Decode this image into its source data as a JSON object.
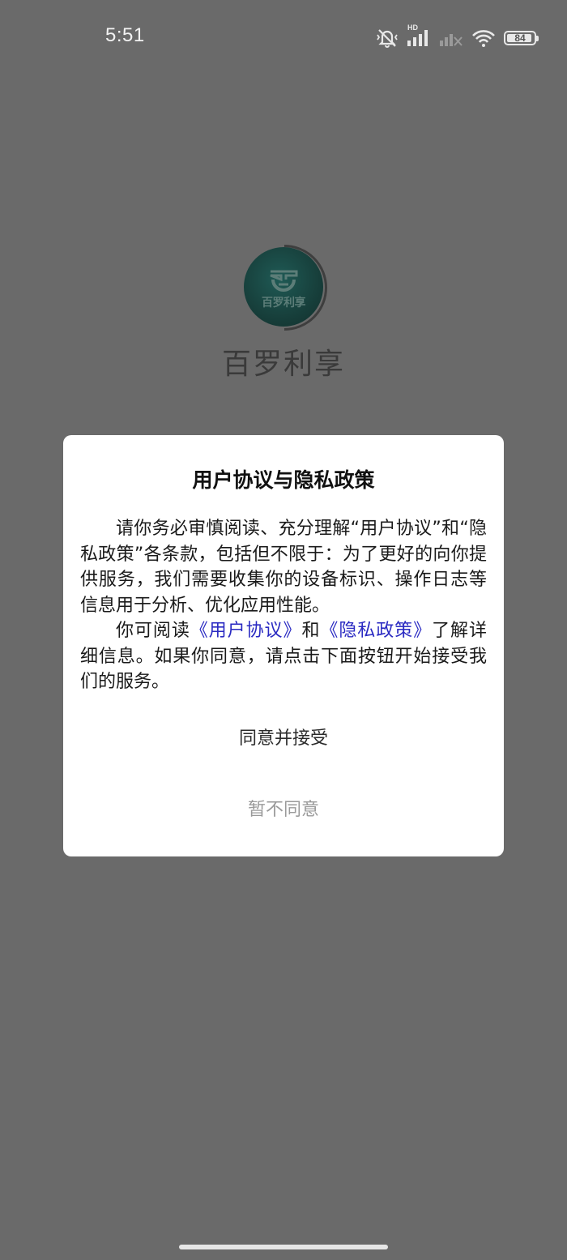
{
  "status_bar": {
    "time": "5:51",
    "network_label": "HD",
    "battery_level": "84",
    "icons": [
      "bell-muted-icon",
      "signal-hd-icon",
      "signal-no-service-icon",
      "wifi-icon",
      "battery-icon"
    ]
  },
  "splash": {
    "logo_text": "百罗利享",
    "app_name": "百罗利享"
  },
  "dialog": {
    "title": "用户协议与隐私政策",
    "paragraph1": "请你务必审慎阅读、充分理解“用户协议”和“隐私政策”各条款，包括但不限于：为了更好的向你提供服务，我们需要收集你的设备标识、操作日志等信息用于分析、优化应用性能。",
    "paragraph2_prefix": "你可阅读",
    "user_agreement_link": "《用户协议》",
    "and_text": "和",
    "privacy_policy_link": "《隐私政策》",
    "paragraph2_suffix": "了解详细信息。如果你同意，请点击下面按钮开始接受我们的服务。",
    "agree_label": "同意并接受",
    "disagree_label": "暂不同意"
  },
  "colors": {
    "overlay": "#6a6a6a",
    "link": "#2a2ac2",
    "logo_bg": "#173f3b",
    "disagree_text": "#9a9a9a"
  }
}
